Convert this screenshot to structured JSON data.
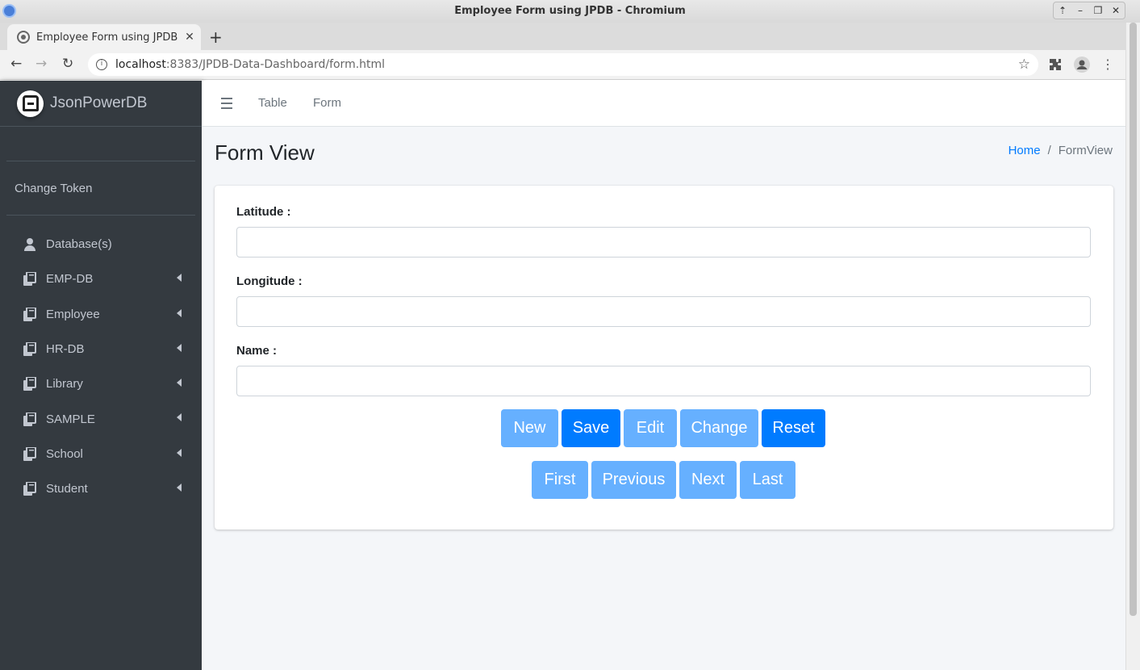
{
  "window": {
    "title": "Employee Form using JPDB - Chromium",
    "controls": [
      "⇡",
      "–",
      "❐",
      "✕"
    ]
  },
  "browser": {
    "tab_title": "Employee Form using JPDB",
    "tab_close": "✕",
    "new_tab": "+",
    "url_host": "localhost",
    "url_path": ":8383/JPDB-Data-Dashboard/form.html",
    "back": "←",
    "forward": "→",
    "reload": "↻"
  },
  "sidebar": {
    "brand": "JsonPowerDB",
    "change_token": "Change Token",
    "items": [
      {
        "label": "Database(s)",
        "icon": "user-icon",
        "expandable": false
      },
      {
        "label": "EMP-DB",
        "icon": "copy-icon",
        "expandable": true
      },
      {
        "label": "Employee",
        "icon": "copy-icon",
        "expandable": true
      },
      {
        "label": "HR-DB",
        "icon": "copy-icon",
        "expandable": true
      },
      {
        "label": "Library",
        "icon": "copy-icon",
        "expandable": true
      },
      {
        "label": "SAMPLE",
        "icon": "copy-icon",
        "expandable": true
      },
      {
        "label": "School",
        "icon": "copy-icon",
        "expandable": true
      },
      {
        "label": "Student",
        "icon": "copy-icon",
        "expandable": true
      }
    ]
  },
  "topnav": {
    "links": [
      "Table",
      "Form"
    ]
  },
  "page": {
    "title": "Form View",
    "breadcrumb": {
      "home": "Home",
      "separator": "/",
      "current": "FormView"
    }
  },
  "form": {
    "fields": [
      {
        "label": "Latitude :",
        "value": ""
      },
      {
        "label": "Longitude :",
        "value": ""
      },
      {
        "label": "Name :",
        "value": ""
      }
    ],
    "actions": [
      {
        "label": "New",
        "enabled": false
      },
      {
        "label": "Save",
        "enabled": true
      },
      {
        "label": "Edit",
        "enabled": false
      },
      {
        "label": "Change",
        "enabled": false
      },
      {
        "label": "Reset",
        "enabled": true
      }
    ],
    "navigation": [
      {
        "label": "First",
        "enabled": false
      },
      {
        "label": "Previous",
        "enabled": false
      },
      {
        "label": "Next",
        "enabled": false
      },
      {
        "label": "Last",
        "enabled": false
      }
    ]
  },
  "colors": {
    "sidebar_bg": "#343a40",
    "primary": "#007bff",
    "primary_disabled": "#66b0ff",
    "content_bg": "#f4f6f9"
  }
}
